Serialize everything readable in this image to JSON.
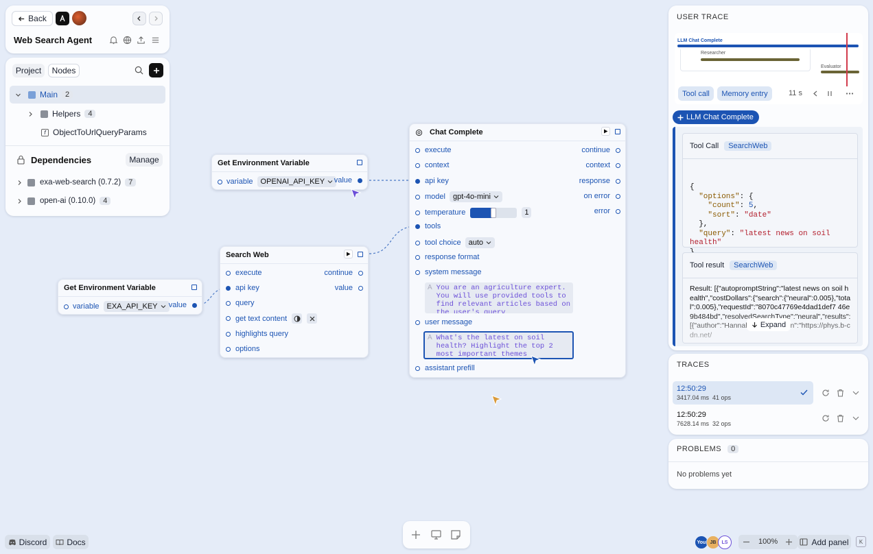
{
  "header": {
    "back_label": "Back",
    "project_name": "Web Search Agent"
  },
  "tree": {
    "tabs": [
      "Project",
      "Nodes"
    ],
    "main_label": "Main",
    "main_count": "2",
    "helpers_label": "Helpers",
    "helpers_count": "4",
    "function_label": "ObjectToUrlQueryParams",
    "deps_title": "Dependencies",
    "manage_label": "Manage",
    "deps": [
      {
        "label": "exa-web-search (0.7.2)",
        "count": "7"
      },
      {
        "label": "open-ai (0.10.0)",
        "count": "4"
      }
    ]
  },
  "nodes": {
    "env1": {
      "title": "Get Environment Variable",
      "variable_label": "variable",
      "variable_value": "OPENAI_API_KEY",
      "out_label": "value"
    },
    "env2": {
      "title": "Get Environment Variable",
      "variable_label": "variable",
      "variable_value": "EXA_API_KEY",
      "out_label": "value"
    },
    "search": {
      "title": "Search Web",
      "inputs": [
        "execute",
        "api key",
        "query",
        "get text content",
        "highlights query",
        "options"
      ],
      "outputs": [
        "continue",
        "value"
      ]
    },
    "chat": {
      "title": "Chat Complete",
      "inputs": [
        "execute",
        "context",
        "api key",
        "model",
        "temperature",
        "tools",
        "tool choice",
        "response format",
        "system message",
        "user message",
        "assistant prefill"
      ],
      "outputs": [
        "continue",
        "context",
        "response",
        "on error",
        "error"
      ],
      "model_value": "gpt-4o-mini",
      "temperature_value": "1",
      "temperature_fraction": 0.5,
      "tool_choice_value": "auto",
      "system_message": "You are an agriculture expert. You will use provided tools to find relevant articles based on the user's query",
      "user_message": "What's the latest on soil health? Highlight the top 2 most important themes"
    }
  },
  "trace": {
    "title": "USER TRACE",
    "timeline": {
      "llm_label": "LLM Chat Complete",
      "researcher_label": "Researcher",
      "evaluator_label": "Evaluator"
    },
    "tool_call_tab": "Tool call",
    "memory_tab": "Memory entry",
    "duration": "11 s",
    "llm_button": "LLM Chat Complete",
    "tool_call_title": "Tool Call",
    "tool_call_tag": "SearchWeb",
    "code_lines": [
      "{",
      "  \"options\": {",
      "    \"count\": 5,",
      "    \"sort\": \"date\"",
      "  },",
      "  \"query\": \"latest news on soil",
      "health\"",
      "}"
    ],
    "tool_result_title": "Tool result",
    "tool_result_tag": "SearchWeb",
    "result_text": "Result: [{\"autopromptString\":\"latest news on soil health\",\"costDollars\":{\"search\":{\"neural\":0.005},\"total\":0.005},\"requestId\":\"8070c47769e4dad1def7 46e9b484bd\",\"resolvedSearchType\":\"neural\",\"results\":[{\"author\":\"Hannah Bird\",\"favicon\":\"https://phys.b-cdn.net/",
    "expand_label": "Expand"
  },
  "traces": {
    "title": "TRACES",
    "items": [
      {
        "time": "12:50:29",
        "stats": "3417.04 ms  41 ops"
      },
      {
        "time": "12:50:29",
        "stats": "7628.14 ms  32 ops"
      }
    ]
  },
  "problems": {
    "title": "PROBLEMS",
    "count": "0",
    "empty": "No problems yet"
  },
  "footer": {
    "discord": "Discord",
    "docs": "Docs",
    "avatars": [
      "You",
      "JB",
      "LS"
    ],
    "zoom": "100%",
    "add_panel": "Add panel",
    "shortcut": "K"
  },
  "colors": {
    "accent": "#1c54b3",
    "canvas": "#e5ecf8",
    "cursor_purple": "#6b4fd8",
    "cursor_blue": "#1c54b3",
    "cursor_orange": "#d99a3a"
  }
}
